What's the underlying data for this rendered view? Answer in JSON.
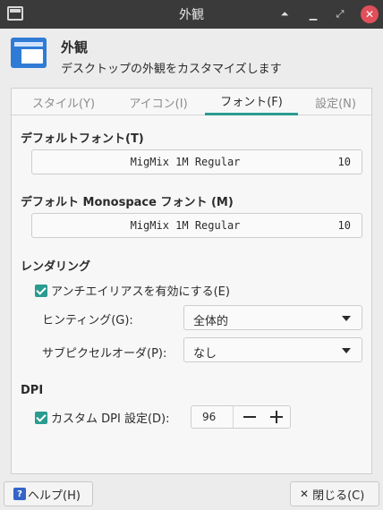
{
  "window": {
    "title": "外観",
    "up_glyph": "⏶",
    "min_glyph": "▁",
    "max_glyph": "⤢",
    "close_glyph": "✕"
  },
  "header": {
    "title": "外観",
    "subtitle": "デスクトップの外観をカスタマイズします"
  },
  "tabs": [
    {
      "label": "スタイル(Y)",
      "active": false
    },
    {
      "label": "アイコン(I)",
      "active": false
    },
    {
      "label": "フォント(F)",
      "active": true
    },
    {
      "label": "設定(N)",
      "active": false
    }
  ],
  "default_font": {
    "label": "デフォルトフォント(T)",
    "name": "MigMix 1M Regular",
    "size": "10"
  },
  "mono_font": {
    "label": "デフォルト Monospace フォント (M)",
    "name": "MigMix 1M Regular",
    "size": "10"
  },
  "rendering": {
    "label": "レンダリング",
    "antialias_label": "アンチエイリアスを有効にする(E)",
    "antialias_checked": true,
    "hinting_label": "ヒンティング(G):",
    "hinting_value": "全体的",
    "subpixel_label": "サブピクセルオーダ(P):",
    "subpixel_value": "なし"
  },
  "dpi": {
    "label": "DPI",
    "custom_label": "カスタム DPI 設定(D):",
    "custom_checked": true,
    "value": "96"
  },
  "buttons": {
    "help_icon": "?",
    "help_label": "ヘルプ(H)",
    "close_icon": "✕",
    "close_label": "閉じる(C)"
  },
  "colors": {
    "accent": "#2a9b8f",
    "titlebar": "#3a3a3a",
    "close": "#e0505a",
    "app_icon": "#2f7bd6"
  }
}
